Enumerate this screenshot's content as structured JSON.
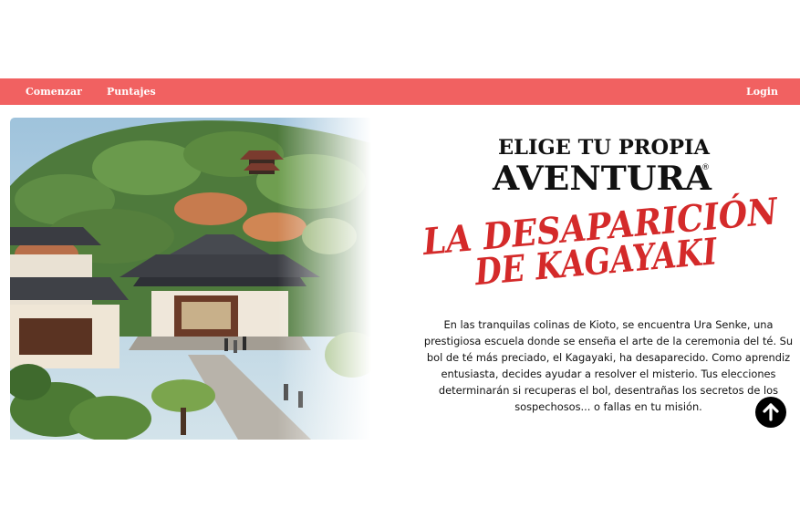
{
  "nav": {
    "start_label": "Comenzar",
    "scores_label": "Puntajes",
    "login_label": "Login"
  },
  "logo": {
    "line1": "ELIGE TU PROPIA",
    "line2": "AVENTURA",
    "registered": "®",
    "title_line1": "LA DESAPARICIÓN",
    "title_line2": "DE KAGAYAKI"
  },
  "intro_text": "En las tranquilas colinas de Kioto, se encuentra Ura Senke, una prestigiosa escuela donde se enseña el arte de la ceremonia del té. Su bol de té más preciado, el Kagayaki, ha desaparecido. Como aprendiz entusiasta, decides ayudar a resolver el misterio. Tus elecciones determinarán si recuperas el bol, desentrañas los secretos de los sospechosos... o fallas en tu misión.",
  "icons": {
    "scroll_top": "arrow-up-icon"
  },
  "colors": {
    "navbar": "#f16161",
    "title_red": "#d42a2a",
    "button": "#000000"
  }
}
